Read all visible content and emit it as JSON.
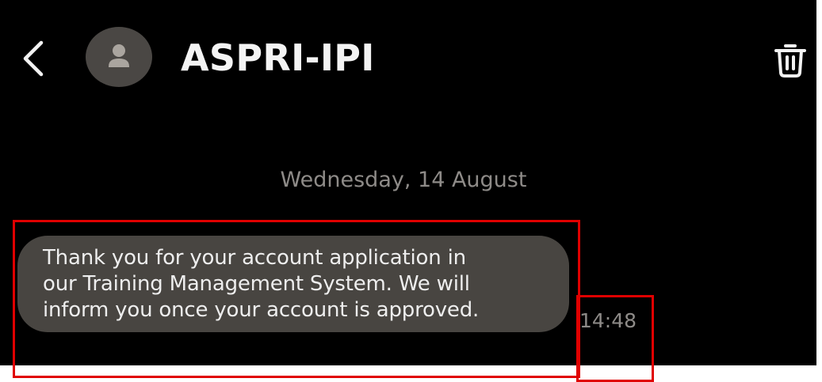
{
  "header": {
    "title": "ASPRI-IPI",
    "back_icon": "chevron-left-icon",
    "avatar_icon": "person-icon",
    "delete_icon": "trash-icon"
  },
  "conversation": {
    "date_separator": "Wednesday, 14 August",
    "messages": [
      {
        "lines": [
          "Thank you for your account application in",
          "our Training Management System. We will",
          "inform you once your account is approved."
        ],
        "time": "14:48"
      }
    ]
  },
  "colors": {
    "background": "#000000",
    "bubble": "#484541",
    "avatar": "#4a4744",
    "muted_text": "#8e8b88",
    "annotation": "#e00000"
  }
}
